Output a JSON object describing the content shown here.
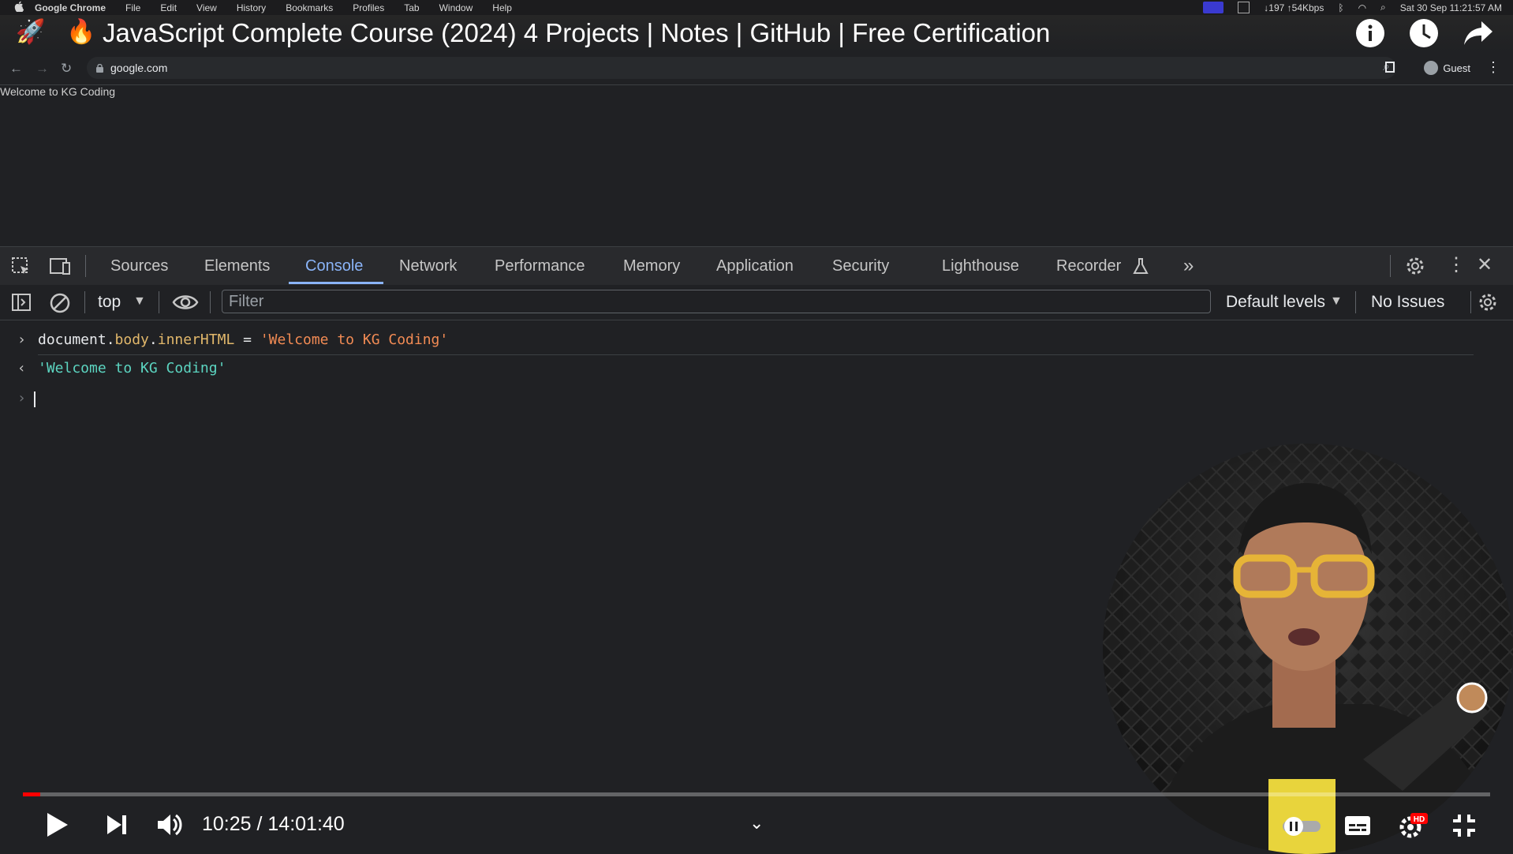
{
  "menubar": {
    "app": "Google Chrome",
    "items": [
      "File",
      "Edit",
      "View",
      "History",
      "Bookmarks",
      "Profiles",
      "Tab",
      "Window",
      "Help"
    ],
    "network": "↓197 ↑54Kbps",
    "clock": "Sat 30 Sep  11:21:57 AM"
  },
  "video": {
    "title": "JavaScript Complete Course (2024) 4 Projects | Notes | GitHub | Free Certification",
    "time": "10:25 / 14:01:40",
    "progress": 0.012
  },
  "browser": {
    "url": "google.com",
    "profile": "Guest"
  },
  "page": {
    "body_text": "Welcome to KG Coding"
  },
  "devtools": {
    "tabs": [
      "Sources",
      "Elements",
      "Console",
      "Network",
      "Performance",
      "Memory",
      "Application",
      "Security",
      "Lighthouse",
      "Recorder"
    ],
    "active_tab": "Console",
    "context": "top",
    "filter_placeholder": "Filter",
    "levels": "Default levels",
    "issues": "No Issues"
  },
  "console": {
    "input": {
      "obj": "document",
      "dot1": ".",
      "prop1": "body",
      "dot2": ".",
      "prop2": "innerHTML",
      "op": " = ",
      "str": "'Welcome to KG Coding'"
    },
    "result": "'Welcome to KG Coding'"
  },
  "colors": {
    "accent": "#8ab4f8",
    "progress": "#ff0000",
    "string": "#f28b54",
    "result": "#5cd5c1"
  }
}
